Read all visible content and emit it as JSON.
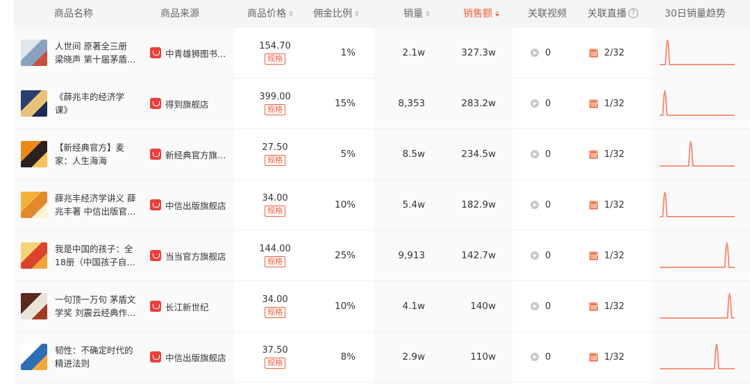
{
  "header": {
    "name": "商品名称",
    "source": "商品来源",
    "price": "商品价格",
    "commission": "佣金比例",
    "sales": "销量",
    "revenue": "销售额",
    "video": "关联视频",
    "live": "关联直播",
    "trend": "30日销量趋势"
  },
  "spec_label": "规格",
  "accent_color": "#f25d3a",
  "trend_color": "#f4866a",
  "rows": [
    {
      "name1": "人世间 原著全三册",
      "name2": "梁晓声 第十届茅盾…",
      "shop": "中青雄狮图书…",
      "price": "154.70",
      "commission": "1%",
      "sales": "2.1w",
      "revenue": "327.3w",
      "video": "0",
      "live": "2/32",
      "spike_day": 3,
      "thumb": [
        "#dfe6ee",
        "#8aa2c0",
        "#c9503f"
      ]
    },
    {
      "name1": "《薛兆丰的经济学",
      "name2": "课》",
      "shop": "得到旗舰店",
      "price": "399.00",
      "commission": "15%",
      "sales": "8,353",
      "revenue": "283.2w",
      "video": "0",
      "live": "1/32",
      "spike_day": 2,
      "thumb": [
        "#2a3f6e",
        "#e9c27a",
        "#1d2c52"
      ]
    },
    {
      "name1": "【新经典官方】麦",
      "name2": "家：人生海海",
      "shop": "新经典官方旗…",
      "price": "27.50",
      "commission": "5%",
      "sales": "8.5w",
      "revenue": "234.5w",
      "video": "0",
      "live": "1/32",
      "spike_day": 12,
      "thumb": [
        "#e98a1c",
        "#2b2220",
        "#f3c25a"
      ]
    },
    {
      "name1": "薛兆丰经济学讲义 薛",
      "name2": "兆丰著 中信出版官…",
      "shop": "中信出版旗舰店",
      "price": "34.00",
      "commission": "10%",
      "sales": "5.4w",
      "revenue": "182.9w",
      "video": "0",
      "live": "1/32",
      "spike_day": 2,
      "thumb": [
        "#f2b33b",
        "#e3892b",
        "#fff3d0"
      ]
    },
    {
      "name1": "我是中国的孩子：全",
      "name2": "18册（中国孩子自…",
      "shop": "当当官方旗舰店",
      "price": "144.00",
      "commission": "25%",
      "sales": "9,913",
      "revenue": "142.7w",
      "video": "0",
      "live": "1/32",
      "spike_day": 26,
      "thumb": [
        "#f4d27a",
        "#d9442b",
        "#f0a43a"
      ]
    },
    {
      "name1": "一句顶一万句 茅盾文",
      "name2": "学奖 刘震云经典作…",
      "shop": "长江新世纪",
      "price": "34.00",
      "commission": "10%",
      "sales": "4.1w",
      "revenue": "140w",
      "video": "0",
      "live": "1/32",
      "spike_day": 27,
      "thumb": [
        "#5a2a1f",
        "#e8e4dc",
        "#a23a22"
      ]
    },
    {
      "name1": "韧性：不确定时代的",
      "name2": "精进法则",
      "shop": "中信出版旗舰店",
      "price": "37.50",
      "commission": "8%",
      "sales": "2.9w",
      "revenue": "110w",
      "video": "0",
      "live": "1/32",
      "spike_day": 22,
      "thumb": [
        "#ffffff",
        "#2f6fb8",
        "#f2a83b"
      ]
    }
  ]
}
